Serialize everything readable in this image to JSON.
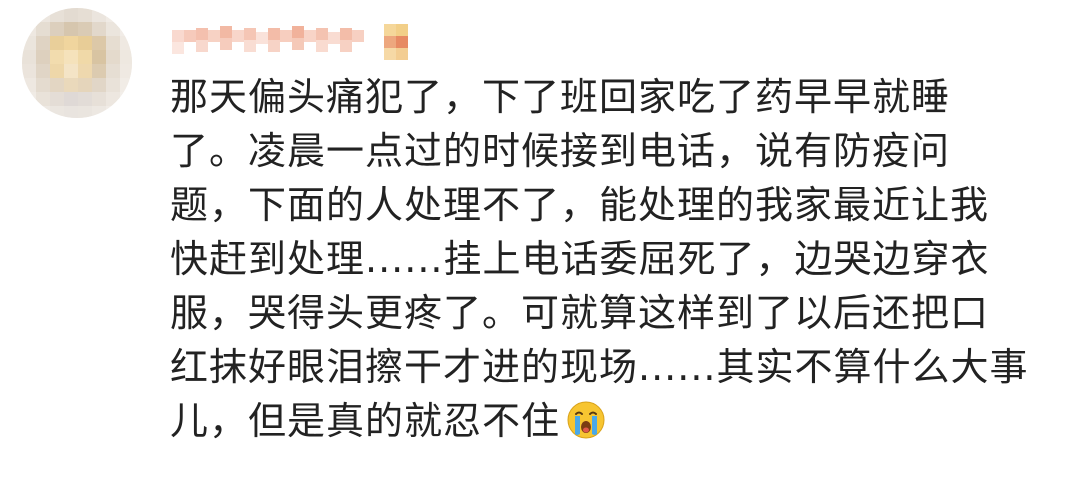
{
  "comment": {
    "lines": [
      "那天偏头痛犯了，下了班回家吃了药早早就睡",
      "了。凌晨一点过的时候接到电话，说有防疫问",
      "题，下面的人处理不了，能处理的我家最近让我",
      "快赶到处理......挂上电话委屈死了，边哭边穿衣",
      "服，哭得头更疼了。可就算这样到了以后还把口",
      "红抹好眼泪擦干才进的现场......其实不算什么大事",
      "儿，但是真的就忍不住"
    ],
    "emoji_icon": "crying-face-icon"
  },
  "colors": {
    "text": "#222222",
    "background": "#ffffff",
    "emoji_face": "#f7c531",
    "emoji_tears": "#4aa8e8"
  }
}
